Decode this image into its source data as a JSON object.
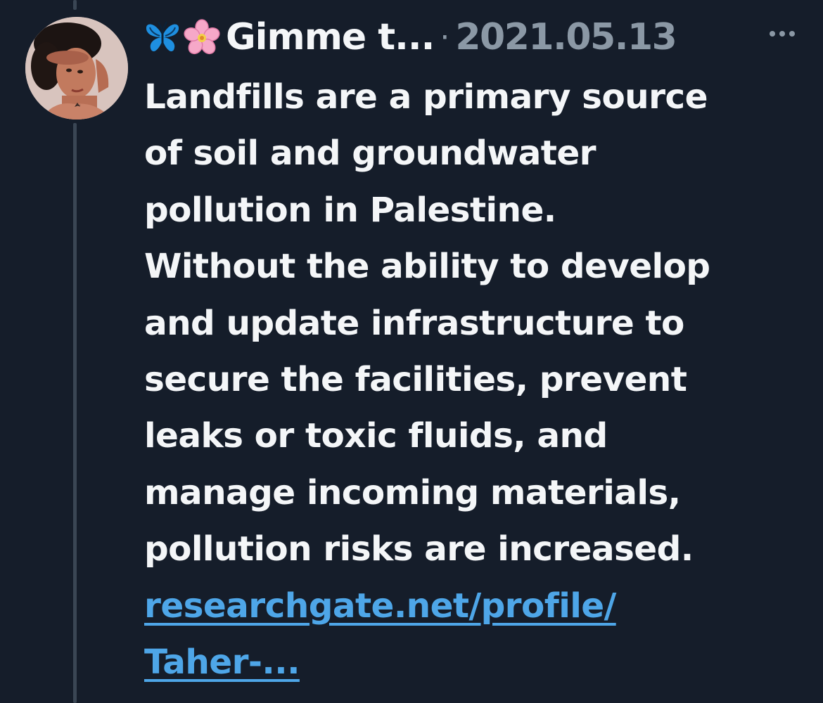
{
  "tweet": {
    "author": {
      "display_name": "Gimme t...",
      "name_emojis": [
        "butterfly-icon",
        "cherry-blossom-icon"
      ]
    },
    "separator": "·",
    "date": "2021.05.13",
    "text_lines": [
      "Landfills are a primary source",
      "of soil and groundwater",
      "pollution in Palestine.",
      "Without the ability to develop",
      "and update infrastructure to",
      "secure the facilities, prevent",
      "leaks or toxic fluids, and",
      "manage incoming materials,",
      "pollution risks are increased."
    ],
    "link_lines": [
      "researchgate.net/profile/",
      "Taher-..."
    ]
  },
  "colors": {
    "background": "#151d2a",
    "text": "#f4f6f8",
    "muted": "#8b98a5",
    "link": "#4ea6e8",
    "thread_line": "#3a4654"
  }
}
